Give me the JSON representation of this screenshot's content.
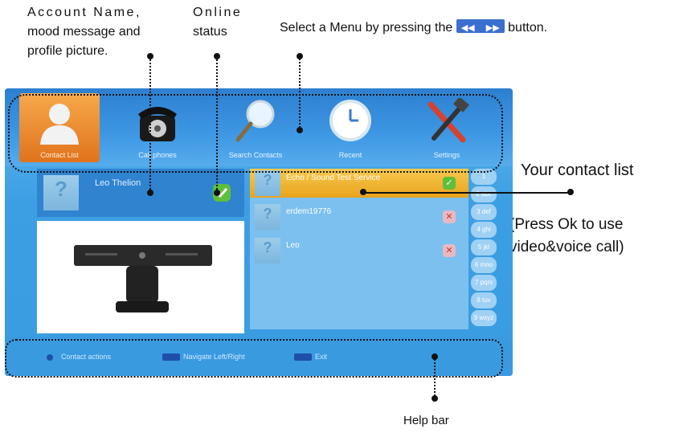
{
  "annotations": {
    "account_line1": "Account Name,",
    "account_line2": "mood message and",
    "account_line3": "profile picture.",
    "online_line1": "Online",
    "online_line2": "status",
    "select_prefix": "Select a Menu by pressing the",
    "select_suffix": "button.",
    "contact_list": "Your contact list",
    "press_line1": "(Press Ok to use",
    "press_line2": "video&voice call)",
    "help_bar": "Help bar"
  },
  "menu": {
    "items": [
      {
        "label": "Contact List",
        "icon": "contact-person-icon",
        "active": true
      },
      {
        "label": "Call phones",
        "icon": "telephone-icon",
        "active": false
      },
      {
        "label": "Search Contacts",
        "icon": "magnifier-icon",
        "active": false
      },
      {
        "label": "Recent",
        "icon": "clock-icon",
        "active": false
      },
      {
        "label": "Settings",
        "icon": "tools-icon",
        "active": false
      }
    ]
  },
  "profile": {
    "name": "Leo Thelion",
    "status": "online"
  },
  "contacts": [
    {
      "name": "Echo / Sound Test Service",
      "status": "online"
    },
    {
      "name": "erdem19776",
      "status": "offline"
    },
    {
      "name": "Leo",
      "status": "offline"
    }
  ],
  "alphabet": [
    "1",
    "2 abc",
    "3 def",
    "4 ghi",
    "5 jkl",
    "6 mno",
    "7 pqrs",
    "8 tuv",
    "9 wxyz"
  ],
  "help": {
    "item1": "Contact actions",
    "item2": "Navigate Left/Right",
    "item3": "Exit"
  },
  "colors": {
    "screen_blue": "#3d9fe3",
    "active_orange": "#e98a2b",
    "highlight_yellow": "#f2b936",
    "online_green": "#5fbf3a",
    "offline_red": "#c0392b"
  }
}
